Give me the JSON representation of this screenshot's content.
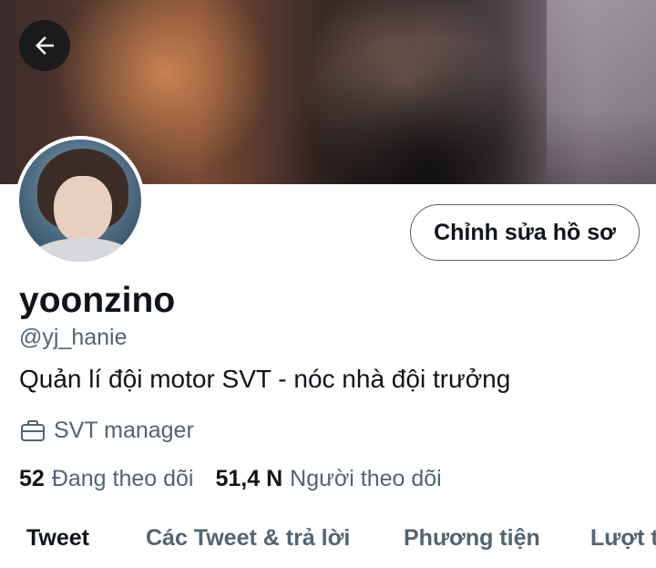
{
  "banner": {
    "back_icon": "arrow-left-icon"
  },
  "profile": {
    "display_name": "yoonzino",
    "handle": "@yj_hanie",
    "bio": "Quản lí đội motor SVT - nóc nhà đội trưởng",
    "work_icon": "briefcase-icon",
    "work": "SVT manager",
    "edit_button": "Chỉnh sửa hồ sơ"
  },
  "stats": {
    "following_count": "52",
    "following_label": "Đang theo dõi",
    "followers_count": "51,4 N",
    "followers_label": "Người theo dõi"
  },
  "tabs": [
    {
      "label": "Tweet",
      "active": true
    },
    {
      "label": "Các Tweet & trả lời",
      "active": false
    },
    {
      "label": "Phương tiện",
      "active": false
    },
    {
      "label": "Lượt t",
      "active": false
    }
  ],
  "colors": {
    "text_primary": "#0f1419",
    "text_secondary": "#536471",
    "background": "#ffffff"
  }
}
